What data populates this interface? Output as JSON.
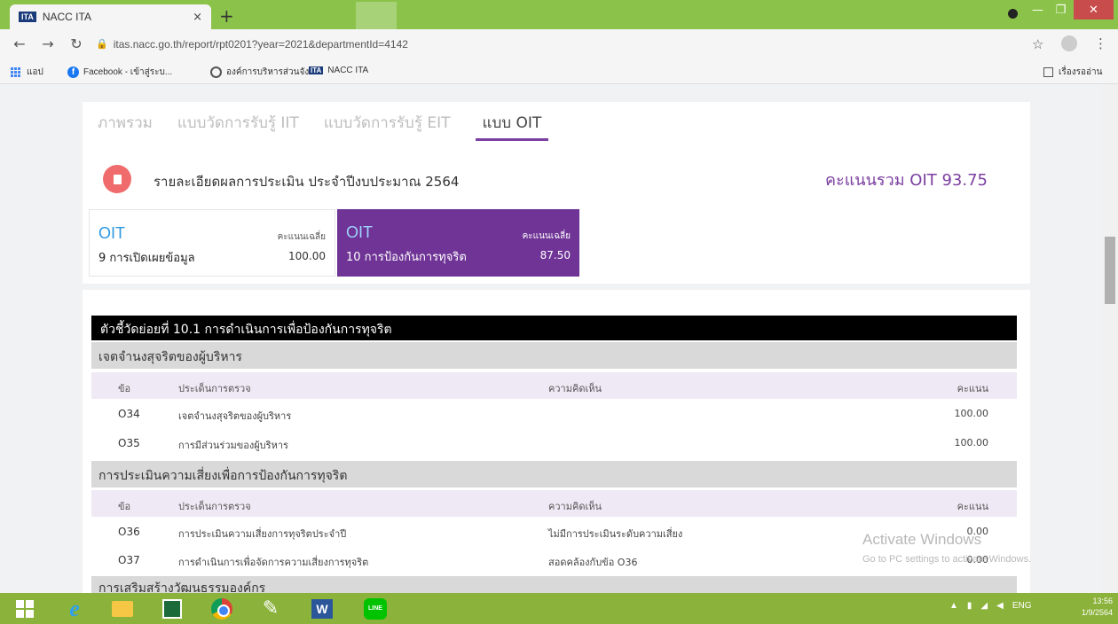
{
  "browser": {
    "tab_title": "NACC ITA",
    "tab_favicon": "ITA",
    "close_glyph": "×",
    "new_tab_glyph": "+",
    "url": "itas.nacc.go.th/report/rpt0201?year=2021&departmentId=4142",
    "bookmarks": {
      "apps": "แอป",
      "facebook": "Facebook - เข้าสู่ระบ...",
      "org": "องค์การบริหารส่วนจังห...",
      "nacc_fav": "ITA",
      "nacc": "NACC ITA",
      "reading_list": "เรื่องรออ่าน"
    }
  },
  "page": {
    "tabs": [
      "ภาพรวม",
      "แบบวัดการรับรู้ IIT",
      "แบบวัดการรับรู้ EIT",
      "แบบ OIT"
    ],
    "report_title": "รายละเอียดผลการประเมิน ประจำปีงบประมาณ 2564",
    "total_score": "คะแนนรวม OIT 93.75",
    "oit_boxes": [
      {
        "label": "OIT",
        "name": "9 การเปิดเผยข้อมูล",
        "avg_label": "คะแนนเฉลี่ย",
        "avg": "100.00"
      },
      {
        "label": "OIT",
        "name": "10 การป้องกันการทุจริต",
        "avg_label": "คะแนนเฉลี่ย",
        "avg": "87.50"
      }
    ],
    "sub_indicator": "ตัวชี้วัดย่อยที่ 10.1 การดำเนินการเพื่อป้องกันการทุจริต",
    "columns": {
      "no": "ข้อ",
      "issue": "ประเด็นการตรวจ",
      "comment": "ความคิดเห็น",
      "score": "คะแนน"
    },
    "sections": [
      {
        "title": "เจตจำนงสุจริตของผู้บริหาร",
        "rows": [
          {
            "no": "O34",
            "issue": "เจตจำนงสุจริตของผู้บริหาร",
            "comment": "",
            "score": "100.00"
          },
          {
            "no": "O35",
            "issue": "การมีส่วนร่วมของผู้บริหาร",
            "comment": "",
            "score": "100.00"
          }
        ]
      },
      {
        "title": "การประเมินความเสี่ยงเพื่อการป้องกันการทุจริต",
        "rows": [
          {
            "no": "O36",
            "issue": "การประเมินความเสี่ยงการทุจริตประจำปี",
            "comment": "ไม่มีการประเมินระดับความเสี่ยง",
            "score": "0.00"
          },
          {
            "no": "O37",
            "issue": "การดำเนินการเพื่อจัดการความเสี่ยงการทุจริต",
            "comment": "สอดคล้องกับข้อ O36",
            "score": "0.00"
          }
        ]
      },
      {
        "title": "การเสริมสร้างวัฒนธรรมองค์กร",
        "rows": []
      }
    ]
  },
  "watermark": {
    "line1": "Activate Windows",
    "line2": "Go to PC settings to activate Windows."
  },
  "taskbar": {
    "word_letter": "W",
    "line_label": "LINE",
    "tray_lang": "ENG",
    "time": "13:56",
    "date": "1/9/2564"
  }
}
